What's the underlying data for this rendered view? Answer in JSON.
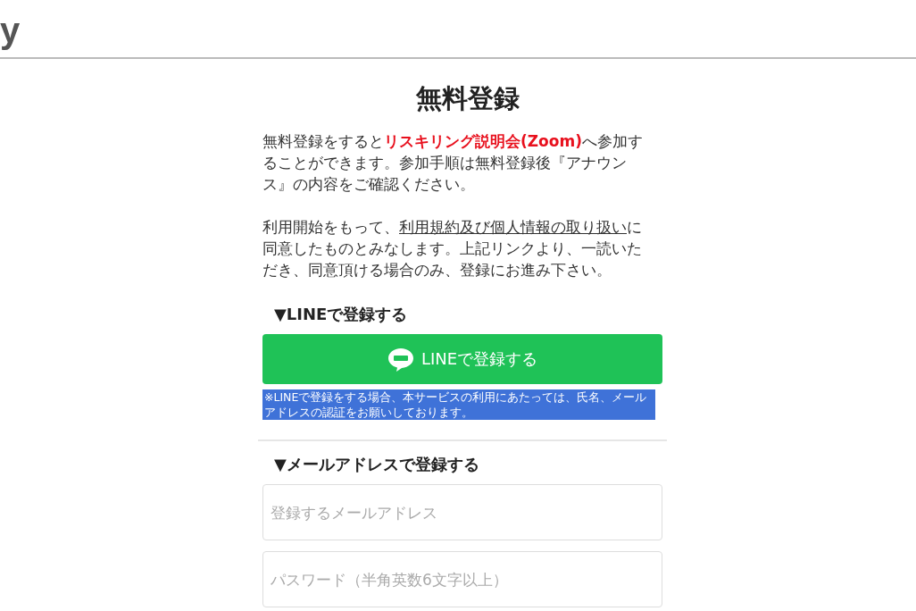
{
  "header": {
    "logo": "y"
  },
  "title": "無料登録",
  "intro": "無料登録をすると**リスキリング説明会(Zoom)**へ参加することができます。参加手順は無料登録後『アナウンス』の内容をご確認ください。",
  "terms": {
    "before": "利用開始をもって、",
    "link": "利用規約及び個人情報の取り扱い",
    "after": "に同意したものとみなします。上記リンクより、一読いただき、同意頂ける場合のみ、登録にお進み下さい。"
  },
  "line_section": {
    "heading": "▼LINEで登録する",
    "button": "LINEで登録する",
    "note": {
      "text": "※LINEで登録をする場合、本サービスの利用にあたっては、氏名、メールアドレスの認証をお願いしております。",
      "selected": true
    }
  },
  "email_section": {
    "heading": "▼メールアドレスで登録する",
    "fields": [
      {
        "placeholder": "登録するメールアドレス"
      },
      {
        "placeholder": "パスワード（半角英数6文字以上）"
      }
    ]
  }
}
